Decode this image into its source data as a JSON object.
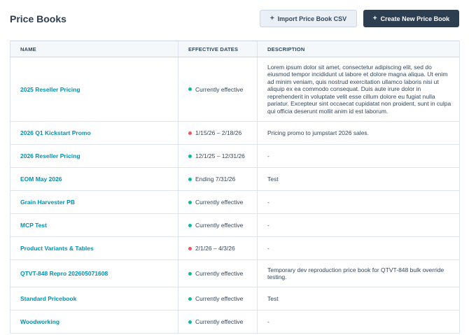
{
  "header": {
    "title": "Price Books",
    "import_label": "Import Price Book CSV",
    "create_label": "Create New Price Book",
    "plus_glyph": "+"
  },
  "table": {
    "columns": [
      "NAME",
      "EFFECTIVE DATES",
      "DESCRIPTION"
    ],
    "status_colors": {
      "green": "#00bda5",
      "red": "#f2545b"
    },
    "rows": [
      {
        "name": "2025 Reseller Pricing",
        "dates": "Currently effective",
        "status": "green",
        "description": "Lorem ipsum dolor sit amet, consectetur adipiscing elit, sed do eiusmod tempor incididunt ut labore et dolore magna aliqua. Ut enim ad minim veniam, quis nostrud exercitation ullamco laboris nisi ut aliquip ex ea commodo consequat. Duis aute irure dolor in reprehenderit in voluptate velit esse cillum dolore eu fugiat nulla pariatur. Excepteur sint occaecat cupidatat non proident, sunt in culpa qui officia deserunt mollit anim id est laborum."
      },
      {
        "name": "2026 Q1 Kickstart Promo",
        "dates": "1/15/26 – 2/18/26",
        "status": "red",
        "description": "Pricing promo to jumpstart 2026 sales."
      },
      {
        "name": "2026 Reseller Pricing",
        "dates": "12/1/25 – 12/31/26",
        "status": "green",
        "description": "-"
      },
      {
        "name": "EOM May 2026",
        "dates": "Ending 7/31/26",
        "status": "green",
        "description": "Test"
      },
      {
        "name": "Grain Harvester PB",
        "dates": "Currently effective",
        "status": "green",
        "description": "-"
      },
      {
        "name": "MCP Test",
        "dates": "Currently effective",
        "status": "green",
        "description": "-"
      },
      {
        "name": "Product Variants & Tables",
        "dates": "2/1/26 – 4/3/26",
        "status": "red",
        "description": "-"
      },
      {
        "name": "QTVT-848 Repro 202605071608",
        "dates": "Currently effective",
        "status": "green",
        "description": "Temporary dev reproduction price book for QTVT-848 bulk override testing."
      },
      {
        "name": "Standard Pricebook",
        "dates": "Currently effective",
        "status": "green",
        "description": "Test"
      },
      {
        "name": "Woodworking",
        "dates": "Currently effective",
        "status": "green",
        "description": "-"
      }
    ]
  }
}
